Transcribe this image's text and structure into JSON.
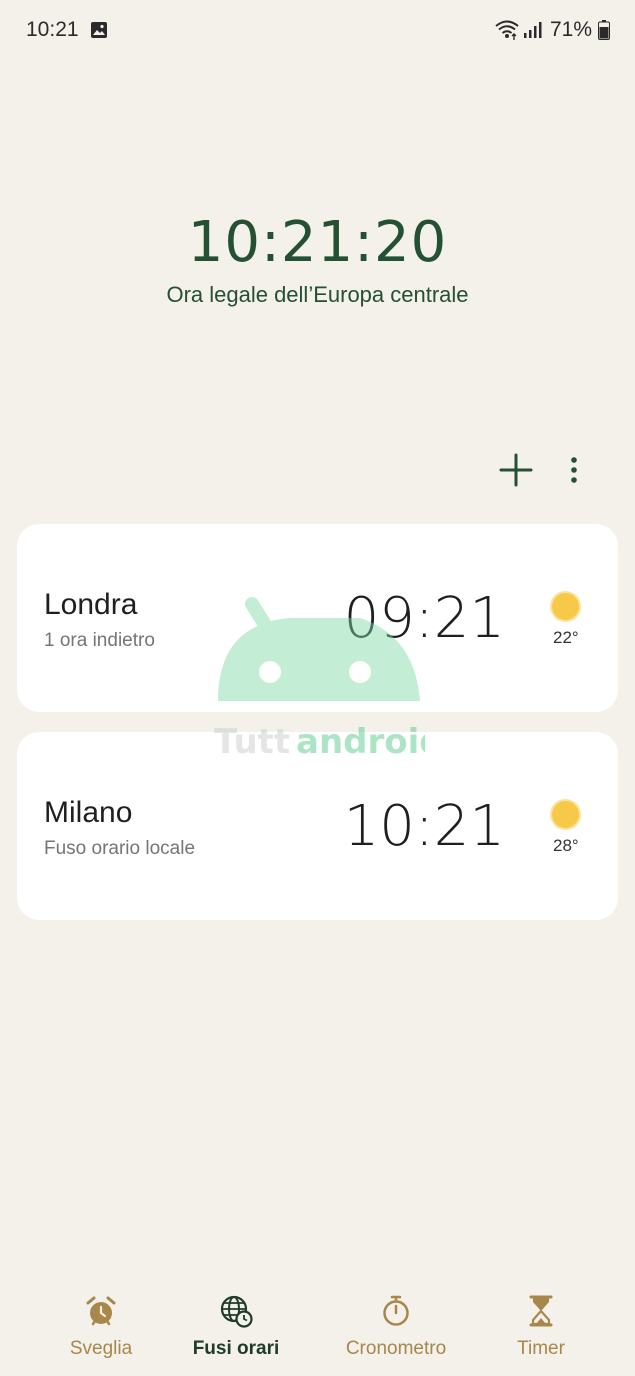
{
  "status_bar": {
    "time": "10:21",
    "battery": "71%",
    "icons": [
      "image-icon",
      "wifi-icon",
      "signal-icon",
      "battery-icon"
    ]
  },
  "main": {
    "time": "10:21:20",
    "zone": "Ora legale dell’Europa centrale"
  },
  "actions": {
    "icons": [
      "add-icon",
      "more-vert-icon"
    ]
  },
  "cities": [
    {
      "name": "Londra",
      "subtitle": "1 ora indietro",
      "time": "09:21",
      "temp": "22°",
      "weather_icon": "sun-icon"
    },
    {
      "name": "Milano",
      "subtitle": "Fuso orario locale",
      "time": "10:21",
      "temp": "28°",
      "weather_icon": "sun-icon"
    }
  ],
  "watermark": {
    "text": "Tuttandroid"
  },
  "nav": {
    "items": [
      {
        "label": "Sveglia",
        "icon": "alarm-clock-icon",
        "active": false
      },
      {
        "label": "Fusi orari",
        "icon": "globe-clock-icon",
        "active": true
      },
      {
        "label": "Cronometro",
        "icon": "stopwatch-icon",
        "active": false
      },
      {
        "label": "Timer",
        "icon": "hourglass-icon",
        "active": false
      }
    ]
  },
  "colors": {
    "background": "#f4f0ea",
    "accent_green": "#245033",
    "nav_inactive": "#a8874a",
    "sun": "#f7c948",
    "card": "#ffffff"
  }
}
